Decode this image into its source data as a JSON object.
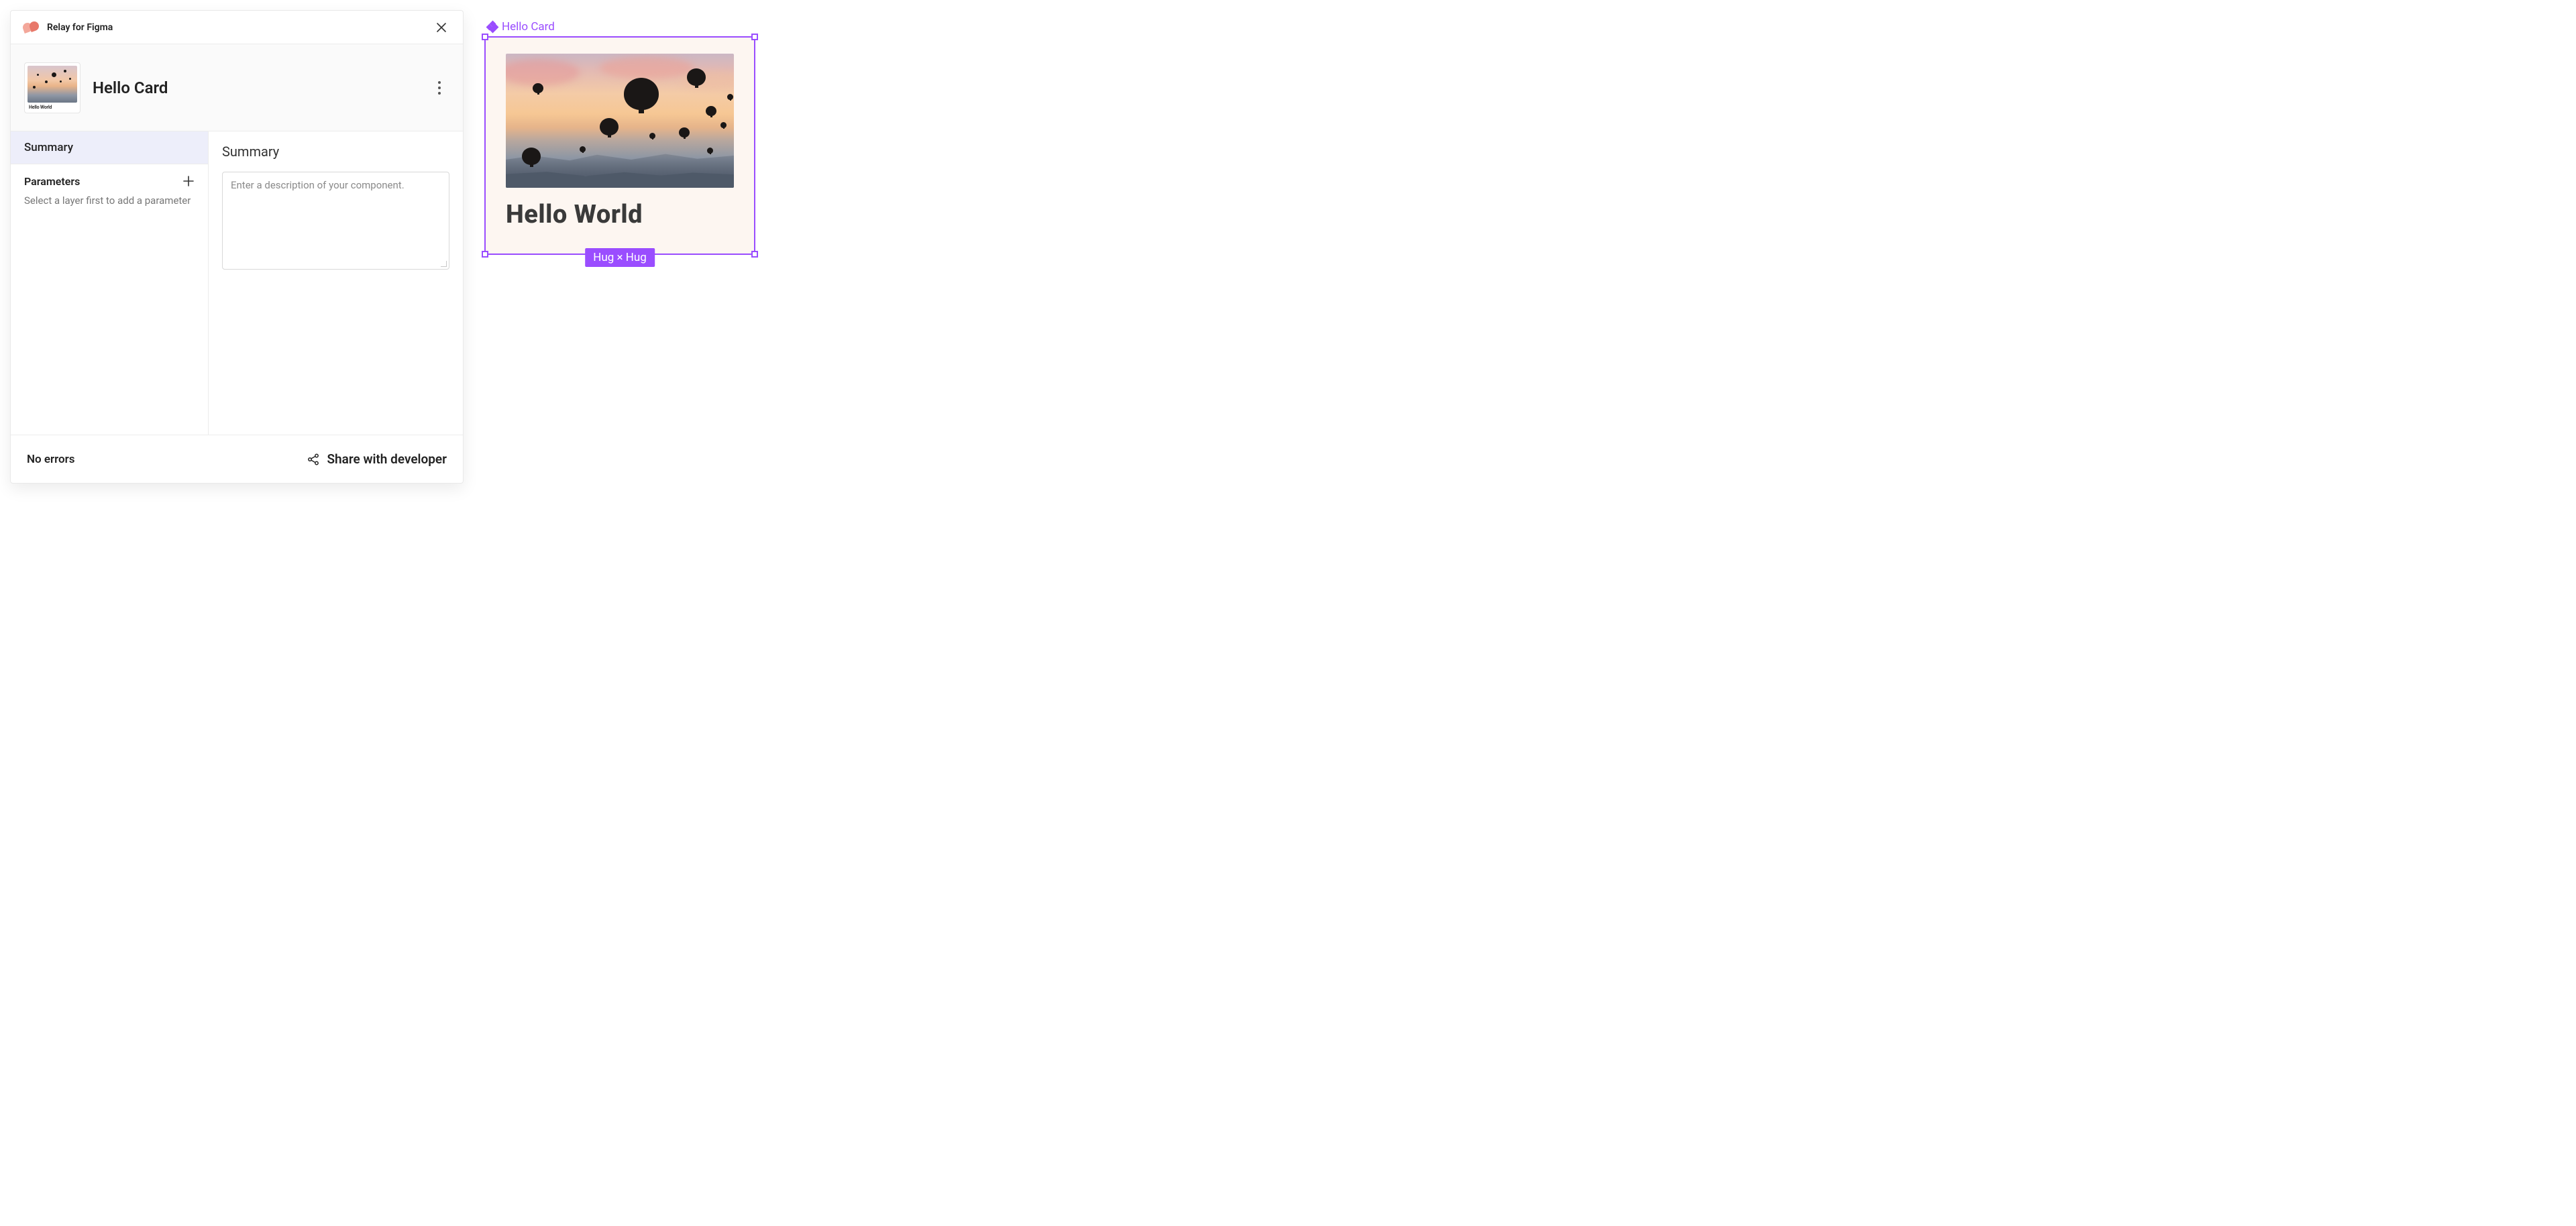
{
  "plugin": {
    "title": "Relay for Figma"
  },
  "header": {
    "component_name": "Hello Card",
    "thumb_caption": "Hello World"
  },
  "sidebar": {
    "tab_summary": "Summary",
    "parameters_title": "Parameters",
    "parameters_help": "Select a layer first to add a parameter"
  },
  "main": {
    "heading": "Summary",
    "desc_placeholder": "Enter a description of your component."
  },
  "footer": {
    "status": "No errors",
    "share": "Share with developer"
  },
  "canvas": {
    "frame_label": "Hello Card",
    "card_text": "Hello World",
    "size_badge": "Hug × Hug"
  }
}
